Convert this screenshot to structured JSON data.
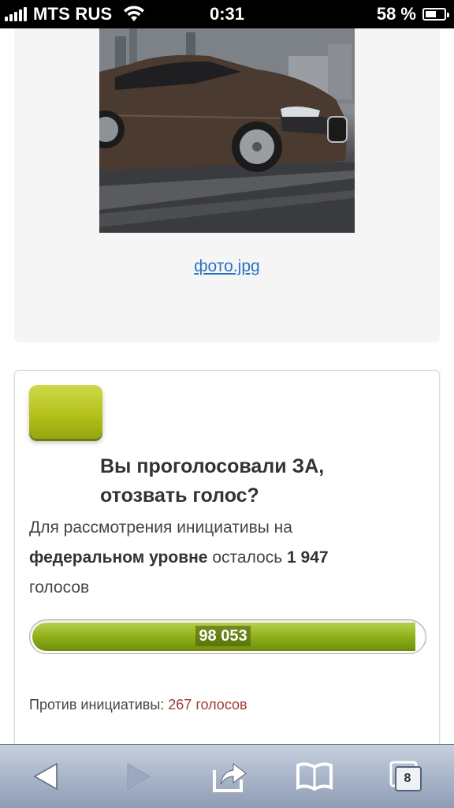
{
  "status_bar": {
    "carrier": "MTS RUS",
    "time": "0:31",
    "battery_percent": "58 %",
    "battery_level": 0.58,
    "signal_bars": 5
  },
  "photo": {
    "link_text": "фото.jpg"
  },
  "vote": {
    "question_line1": "Вы проголосовали ЗА,",
    "question_line2": "отозвать голос?",
    "info_prefix": "Для рассмотрения инициативы на",
    "info_bold": "федеральном уровне",
    "info_mid": "осталось",
    "info_count": "1 947",
    "info_suffix": "голосов",
    "progress_label": "98 053",
    "progress_fraction": 0.98,
    "against_label": "Против инициативы:",
    "against_count": "267 голосов",
    "colors": {
      "button_green": "#b4c21a",
      "progress_green": "#8fb019",
      "against_red": "#a23a33",
      "link_blue": "#2a73c4"
    }
  },
  "toolbar": {
    "tab_count": "8",
    "icons": [
      "back-icon",
      "forward-icon",
      "share-icon",
      "bookmarks-icon",
      "tabs-icon"
    ]
  }
}
